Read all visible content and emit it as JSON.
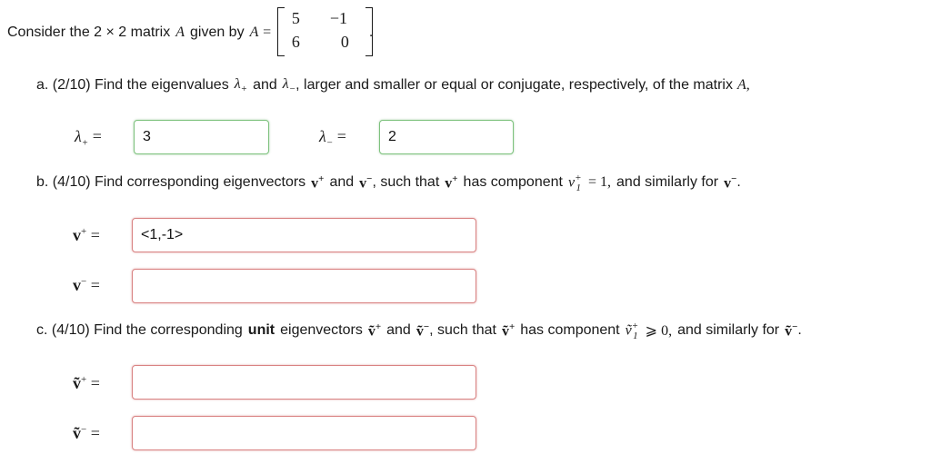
{
  "intro": {
    "text_before": "Consider the 2 × 2 matrix",
    "matrix_name": "A",
    "text_given": "given by",
    "equals": "A =",
    "matrix": [
      [
        "5",
        "−1"
      ],
      [
        "6",
        "0"
      ]
    ],
    "end": "."
  },
  "part_a": {
    "prompt_start": "a. (2/10) Find the eigenvalues",
    "lambda_plus": "λ",
    "plus_sub": "+",
    "and": "and",
    "lambda_minus": "λ",
    "minus_sub": "−",
    "prompt_end": ", larger and smaller or equal or conjugate, respectively, of the matrix",
    "matrix_ref": "A,",
    "answer_plus_label": "λ",
    "answer_minus_label": "λ",
    "answer_plus_value": "3",
    "answer_minus_value": "2"
  },
  "part_b": {
    "prompt_start": "b. (4/10) Find corresponding eigenvectors",
    "v": "v",
    "plus": "+",
    "and": "and",
    "minus": "−",
    "mid": ", such that",
    "has_component": "has component",
    "component": "v",
    "comp_sup": "+",
    "comp_sub": "1",
    "eq_one": "= 1,",
    "prompt_end": "and similarly for",
    "end": ".",
    "answer_plus_value": "<1,-1>",
    "answer_minus_value": ""
  },
  "part_c": {
    "prompt_start": "c. (4/10) Find the corresponding",
    "unit": "unit",
    "eigen": "eigenvectors",
    "v": "ṽ",
    "plus": "+",
    "and": "and",
    "minus": "−",
    "mid": ", such that",
    "has_component": "has component",
    "component": "ṽ",
    "comp_sup": "+",
    "comp_sub": "1",
    "geq_zero": "⩾ 0,",
    "prompt_end": "and similarly for",
    "end": ".",
    "answer_plus_value": "",
    "answer_minus_value": ""
  },
  "symbols": {
    "equals": "="
  }
}
